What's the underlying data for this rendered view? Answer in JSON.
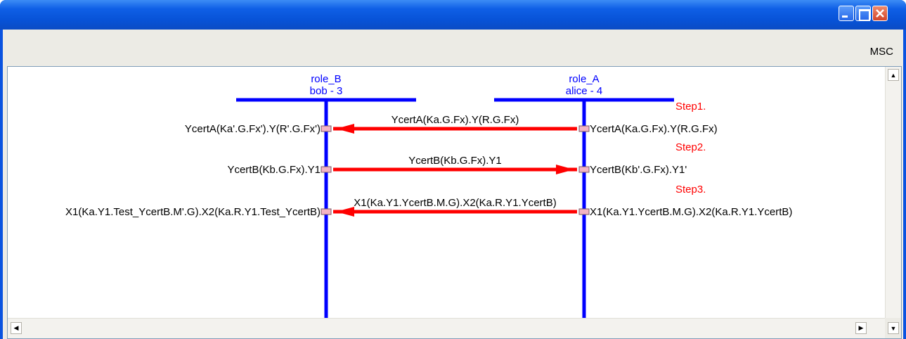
{
  "window": {
    "header_label": "MSC",
    "controls": {
      "minimize_icon": "minimize-icon",
      "maximize_icon": "maximize-icon",
      "close_icon": "close-icon"
    }
  },
  "diagram": {
    "roles": [
      {
        "role": "role_B",
        "agent": "bob - 3"
      },
      {
        "role": "role_A",
        "agent": "alice - 4"
      }
    ],
    "steps": [
      {
        "step": "Step1.",
        "message": "YcertA(Ka.G.Fx).Y(R.G.Fx)",
        "left_label": "YcertA(Ka'.G.Fx').Y(R'.G.Fx')",
        "right_label": "YcertA(Ka.G.Fx).Y(R.G.Fx)",
        "direction": "right-to-left"
      },
      {
        "step": "Step2.",
        "message": "YcertB(Kb.G.Fx).Y1",
        "left_label": "YcertB(Kb.G.Fx).Y1",
        "right_label": "YcertB(Kb'.G.Fx).Y1'",
        "direction": "left-to-right"
      },
      {
        "step": "Step3.",
        "message": "X1(Ka.Y1.YcertB.M.G).X2(Ka.R.Y1.YcertB)",
        "left_label": "X1(Ka.Y1.Test_YcertB.M'.G).X2(Ka.R.Y1.Test_YcertB)",
        "right_label": "X1(Ka.Y1.YcertB.M.G).X2(Ka.R.Y1.YcertB)",
        "direction": "right-to-left"
      }
    ],
    "colors": {
      "lifeline": "#0000ff",
      "message": "#ff0000",
      "step_label": "#ff0000",
      "role_label": "#0000ff",
      "port": "#f4b4c4"
    }
  }
}
